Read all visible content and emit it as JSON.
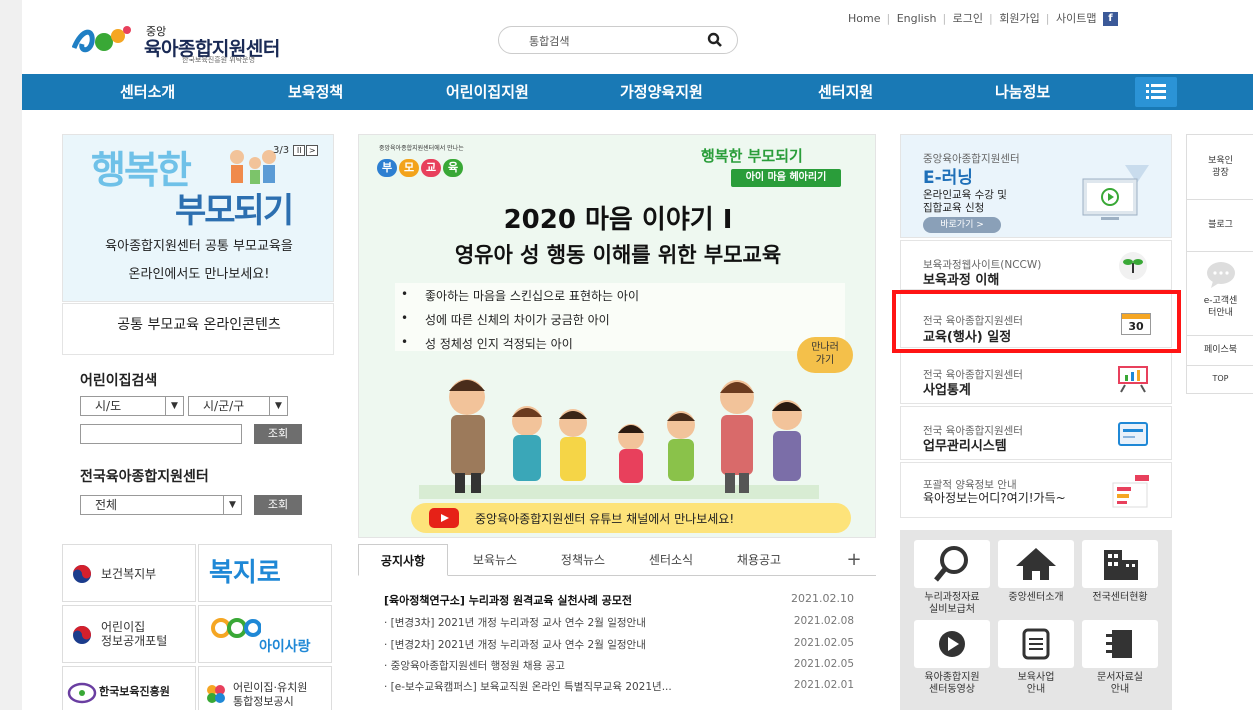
{
  "header": {
    "logo_top": "중앙",
    "logo_main": "육아종합지원센터",
    "logo_sub": "한국보육진흥원 위탁운영",
    "search_placeholder": "통합검색",
    "top_links": [
      "Home",
      "English",
      "로그인",
      "회원가입",
      "사이트맵"
    ],
    "facebook": "f"
  },
  "nav": {
    "items": [
      "센터소개",
      "보육정책",
      "어린이집지원",
      "가정양육지원",
      "센터지원",
      "나눔정보"
    ]
  },
  "left": {
    "promo_title_1": "행복한",
    "promo_title_2": "부모되기",
    "promo_line_1": "육아종합지원센터 공통 부모교육을",
    "promo_line_2": "온라인에서도 만나보세요!",
    "promo_pager": "3/3",
    "promo_ctrl_pause": "II",
    "promo_ctrl_next": ">",
    "promo_caption": "공통 부모교육 온라인콘텐츠",
    "daycare_search_title": "어린이집검색",
    "sido": "시/도",
    "sigungu": "시/군/구",
    "search_btn": "조회",
    "center_title": "전국육아종합지원센터",
    "center_select": "전체",
    "center_btn": "조회",
    "banners": [
      {
        "label": "보건복지부"
      },
      {
        "label": "복지로"
      },
      {
        "label": "어린이집\n정보공개포털"
      },
      {
        "label": "아이사랑"
      },
      {
        "label": "한국보육진흥원"
      },
      {
        "label": "어린이집·유치원\n통합정보공시"
      }
    ]
  },
  "center": {
    "org_small": "중앙육아종합지원센터에서 만나는",
    "pills": [
      "부",
      "모",
      "교",
      "육"
    ],
    "kicker": "행복한 부모되기",
    "kicker_tag": "아이 마음 헤아리기",
    "title": "2020 마음 이야기 I",
    "subtitle": "영유아 성 행동 이해를 위한 부모교육",
    "items": [
      "좋아하는 마음을 스킨십으로 표현하는 아이",
      "성에 따른 신체의 차이가 궁금한 아이",
      "성 정체성 인지 걱정되는 아이"
    ],
    "bubble": "만나러\n가기",
    "youtube_text": "중앙육아종합지원센터 유튜브 채널에서 만나보세요!",
    "youtube_bold": "유튜브 채널에서 만나보세요!"
  },
  "notice": {
    "tabs": [
      "공지사항",
      "보육뉴스",
      "정책뉴스",
      "센터소식",
      "채용공고"
    ],
    "plus": "+",
    "headline": "[육아정책연구소] 누리과정 원격교육 실천사례 공모전",
    "headline_date": "2021.02.10",
    "rows": [
      {
        "title": "· [변경3차] 2021년 개정 누리과정 교사 연수 2월 일정안내",
        "date": "2021.02.08"
      },
      {
        "title": "· [변경2차] 2021년 개정 누리과정 교사 연수 2월 일정안내",
        "date": "2021.02.05"
      },
      {
        "title": "· 중앙육아종합지원센터 행정원 채용 공고",
        "date": "2021.02.05"
      },
      {
        "title": "· [e-보수교육캠퍼스] 보육교직원 온라인 특별직무교육 2021년...",
        "date": "2021.02.01"
      }
    ]
  },
  "right": {
    "elearn_small": "중앙육아종합지원센터",
    "elearn_big": "E-러닝",
    "elearn_desc_1": "온라인교육 수강 및",
    "elearn_desc_2": "집합교육 신청",
    "elearn_btn": "바로가기 >",
    "items": [
      {
        "small": "보육과정웹사이트(NCCW)",
        "big": "보육과정 이해"
      },
      {
        "small": "전국 육아종합지원센터",
        "big": "교육(행사) 일정"
      },
      {
        "small": "전국 육아종합지원센터",
        "big": "사업통계"
      },
      {
        "small": "전국 육아종합지원센터",
        "big": "업무관리시스템"
      },
      {
        "small": "포괄적 양육정보 안내",
        "big": "육아정보는어디?여기!가득~"
      }
    ],
    "calendar_day": "30",
    "tiles": [
      {
        "label": "누리과정자료\n실비보급처"
      },
      {
        "label": "중앙센터소개"
      },
      {
        "label": "전국센터현황"
      },
      {
        "label": "육아종합지원\n센터동영상"
      },
      {
        "label": "보육사업\n안내"
      },
      {
        "label": "문서자료실\n안내"
      }
    ]
  },
  "quick": {
    "items": [
      "보육인\n광장",
      "블로그",
      "e-고객센\n터안내",
      "페이스북",
      "TOP"
    ]
  },
  "colors": {
    "nav": "#1979b5",
    "highlight": "#ff1414",
    "accent_green": "#2a9d3a",
    "tile_bg": "#e5e5e5"
  }
}
